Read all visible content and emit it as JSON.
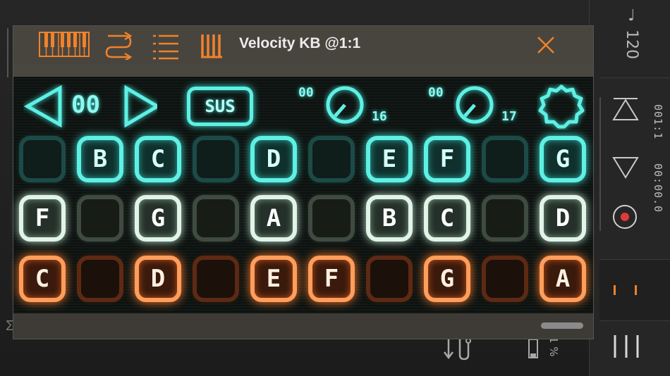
{
  "window": {
    "title": "Velocity KB @1:1"
  },
  "toolbar": {
    "icons": [
      "piano-keys-icon",
      "routing-icon",
      "list-icon",
      "bars-icon",
      "close-icon"
    ]
  },
  "controls": {
    "octave_value": "00",
    "sustain_label": "SUS",
    "knob1": {
      "value": "00",
      "label": "16"
    },
    "knob2": {
      "value": "00",
      "label": "17"
    }
  },
  "rows": [
    {
      "color": "cyan",
      "keys": [
        "",
        "B",
        "C",
        "",
        "D",
        "",
        "E",
        "F",
        "",
        "G"
      ]
    },
    {
      "color": "white",
      "keys": [
        "F",
        "",
        "G",
        "",
        "A",
        "",
        "B",
        "C",
        "",
        "D"
      ]
    },
    {
      "color": "orange",
      "keys": [
        "C",
        "",
        "D",
        "",
        "E",
        "F",
        "",
        "G",
        "",
        "A"
      ]
    }
  ],
  "sidebar": {
    "tempo": "♩ 120",
    "position": "001:1",
    "time": "00:00.0",
    "percent": "1 %"
  },
  "colors": {
    "accent_orange": "#f0822a",
    "cyan_glow": "#5ff0e4",
    "record_red": "#e03a3a"
  }
}
